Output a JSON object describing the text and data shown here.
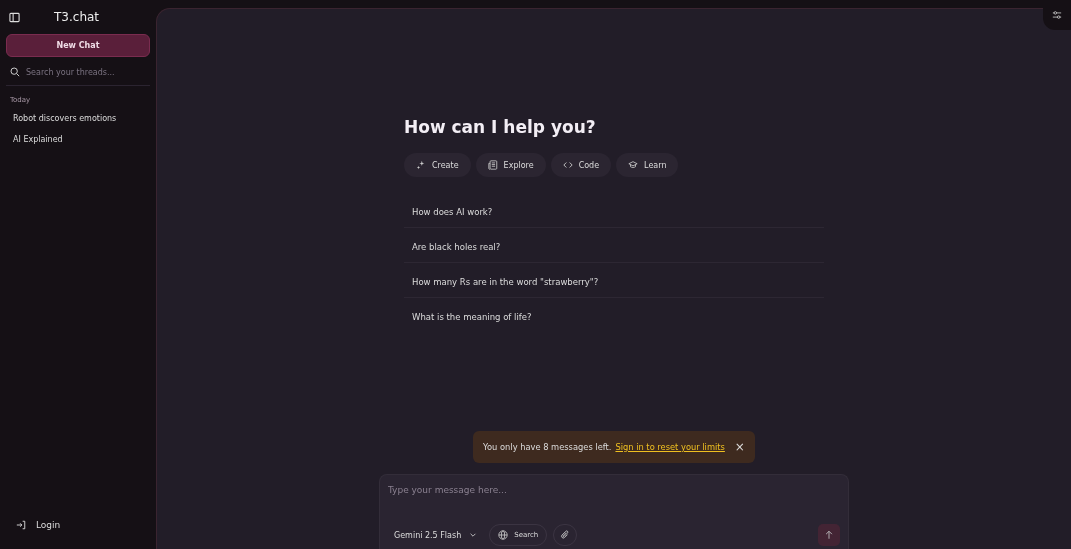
{
  "sidebar": {
    "brand": "T3.chat",
    "new_chat": "New Chat",
    "search": {
      "placeholder": "Search your threads..."
    },
    "groups": [
      {
        "label": "Today",
        "threads": [
          {
            "title": "Robot discovers emotions"
          },
          {
            "title": "AI Explained"
          }
        ]
      }
    ],
    "login": "Login"
  },
  "main": {
    "heading": "How can I help you?",
    "categories": [
      {
        "kind": "create",
        "label": "Create"
      },
      {
        "kind": "explore",
        "label": "Explore"
      },
      {
        "kind": "code",
        "label": "Code"
      },
      {
        "kind": "learn",
        "label": "Learn"
      }
    ],
    "suggestions": [
      "How does AI work?",
      "Are black holes real?",
      "How many Rs are in the word \"strawberry\"?",
      "What is the meaning of life?"
    ],
    "toast": {
      "message": "You only have 8 messages left.",
      "link": "Sign in to reset your limits",
      "close": "×"
    },
    "composer": {
      "placeholder": "Type your message here...",
      "model": "Gemini 2.5 Flash",
      "search": "Search",
      "send_disabled": true
    }
  }
}
